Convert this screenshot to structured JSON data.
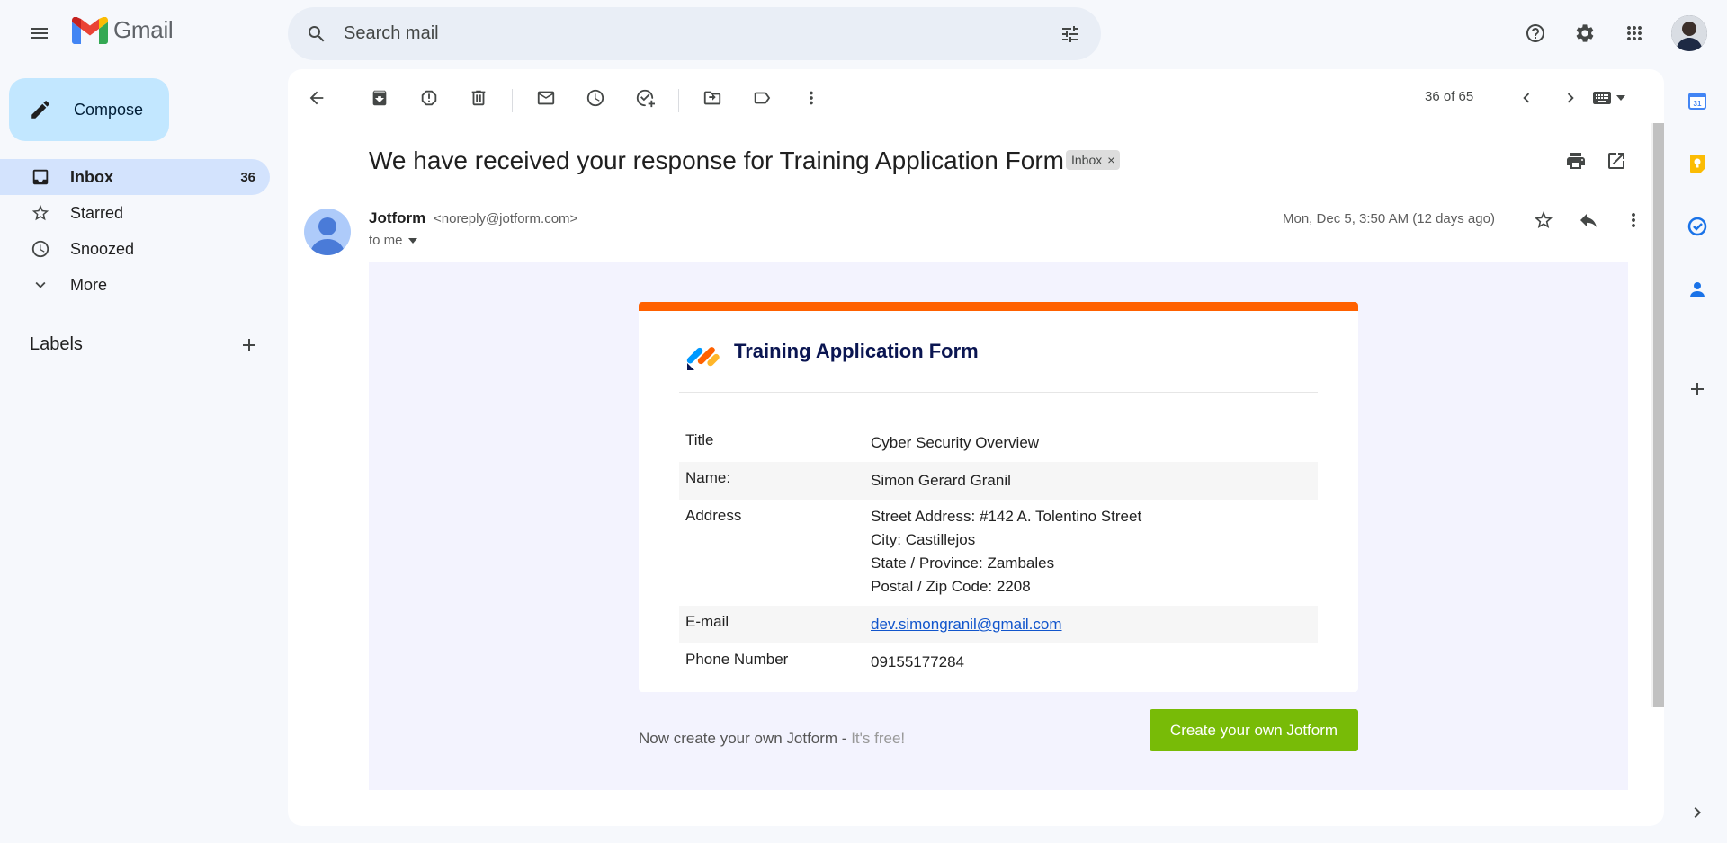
{
  "header": {
    "logo_text": "Gmail",
    "search_placeholder": "Search mail"
  },
  "nav": {
    "compose_label": "Compose",
    "items": [
      {
        "label": "Inbox",
        "count": "36"
      },
      {
        "label": "Starred",
        "count": ""
      },
      {
        "label": "Snoozed",
        "count": ""
      },
      {
        "label": "More",
        "count": ""
      }
    ],
    "labels_title": "Labels"
  },
  "toolbar": {
    "pager": "36 of 65"
  },
  "message": {
    "subject": "We have received your response for Training Application Form",
    "chip_label": "Inbox",
    "chip_close": "×",
    "sender_name": "Jotform",
    "sender_email": "<noreply@jotform.com>",
    "to": "to me",
    "date": "Mon, Dec 5, 3:50 AM (12 days ago)"
  },
  "email": {
    "form_title": "Training Application Form",
    "rows": [
      {
        "label": "Title",
        "value": "Cyber Security Overview"
      },
      {
        "label": "Name:",
        "value": "Simon Gerard Granil"
      },
      {
        "label": "Address",
        "lines": [
          "Street Address: #142 A. Tolentino Street",
          "City: Castillejos",
          "State / Province: Zambales",
          "Postal / Zip Code: 2208"
        ]
      },
      {
        "label": "E-mail",
        "value": "dev.simongranil@gmail.com"
      },
      {
        "label": "Phone Number",
        "value": "09155177284"
      }
    ],
    "footer_text": "Now create your own Jotform - ",
    "footer_free": "It's free!",
    "cta_label": "Create your own Jotform"
  },
  "side_panel": {
    "calendar_day": "31"
  },
  "colors": {
    "accent_orange": "#ff6100",
    "cta_green": "#78bb07",
    "compose_bg": "#c2e7ff",
    "inbox_active_bg": "#d3e3fd",
    "form_title": "#0a1551"
  },
  "icons": [
    "menu-icon",
    "search-icon",
    "tune-icon",
    "help-icon",
    "gear-icon",
    "apps-icon",
    "pencil-icon",
    "inbox-icon",
    "star-icon",
    "clock-icon",
    "chevron-down-icon",
    "plus-icon",
    "back-arrow-icon",
    "archive-icon",
    "report-spam-icon",
    "delete-icon",
    "mark-unread-icon",
    "snooze-icon",
    "add-task-icon",
    "move-to-icon",
    "label-icon",
    "more-vert-icon",
    "chevron-left-icon",
    "chevron-right-icon",
    "keyboard-icon",
    "print-icon",
    "open-new-window-icon",
    "reply-icon",
    "calendar-icon",
    "keep-icon",
    "tasks-icon",
    "contacts-icon",
    "chevron-right-expand-icon"
  ]
}
